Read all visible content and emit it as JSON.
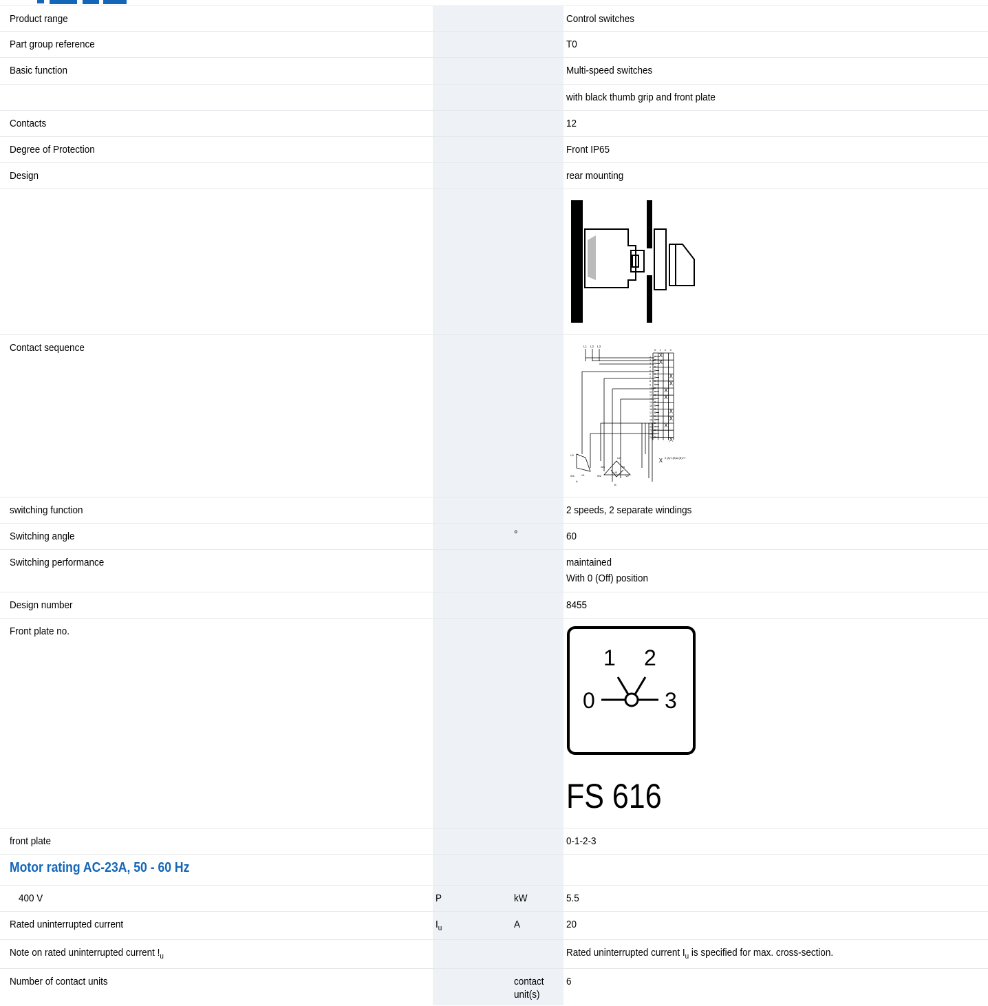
{
  "rows": [
    {
      "label": "Product range",
      "value": "Control switches"
    },
    {
      "label": "Part group reference",
      "value": "T0"
    },
    {
      "label": "Basic function",
      "value": "Multi-speed switches"
    },
    {
      "label": "",
      "value": "with black thumb grip and front plate"
    },
    {
      "label": "Contacts",
      "value": "12"
    },
    {
      "label": "Degree of Protection",
      "value": "Front IP65"
    },
    {
      "label": "Design",
      "value": "rear mounting"
    },
    {
      "label": "Contact sequence"
    },
    {
      "label": "switching function",
      "value": "2 speeds, 2 separate windings"
    },
    {
      "label": "Switching angle",
      "unit": "°",
      "value": "60"
    },
    {
      "label": "Switching performance",
      "value_line1": "maintained",
      "value_line2": "With 0 (Off) position"
    },
    {
      "label": "Design number",
      "value": "8455"
    },
    {
      "label": "Front plate no.",
      "plate_code": "FS 616"
    },
    {
      "label": "front plate",
      "value": "0-1-2-3"
    }
  ],
  "front_plate_positions": [
    "0",
    "1",
    "2",
    "3"
  ],
  "section_motor": "Motor rating AC-23A, 50 - 60 Hz",
  "motor_rows": [
    {
      "label": "400 V",
      "symbol": "P",
      "unit": "kW",
      "value": "5.5"
    },
    {
      "label": "Rated uninterrupted current",
      "symbol": "I",
      "symbol_sub": "u",
      "unit": "A",
      "value": "20"
    },
    {
      "label": "Note on rated uninterrupted current !",
      "label_sub": "u",
      "value_pre": "Rated uninterrupted current I",
      "value_sub": "u",
      "value_post": " is specified for max. cross-section."
    },
    {
      "label": "Number of contact units",
      "unit_line1": "contact",
      "unit_line2": "unit(s)",
      "value": "6"
    }
  ],
  "diagram": {
    "phase_labels": [
      "L1",
      "L2",
      "L3"
    ],
    "position_header": [
      "0",
      "1",
      "2",
      "3"
    ],
    "terminals": [
      "1",
      "2",
      "3",
      "4",
      "5",
      "6",
      "7",
      "8",
      "9",
      "10",
      "11",
      "12",
      "13",
      "14",
      "15",
      "16",
      "17",
      "18",
      "19",
      "20",
      "21",
      "22",
      "23",
      "24"
    ],
    "motor_a_labels": [
      "U1",
      "W1",
      "V1",
      "A"
    ],
    "motor_b_labels": [
      "W3",
      "U2",
      "U3",
      "V3",
      "W2",
      "V2",
      "B"
    ],
    "footer": "0 (A)Y-(B)Δ-(B)YY"
  },
  "colors": {
    "heading_blue": "#1366b8",
    "grey_column": "#eef1f6",
    "row_line": "#e6e8ec"
  }
}
